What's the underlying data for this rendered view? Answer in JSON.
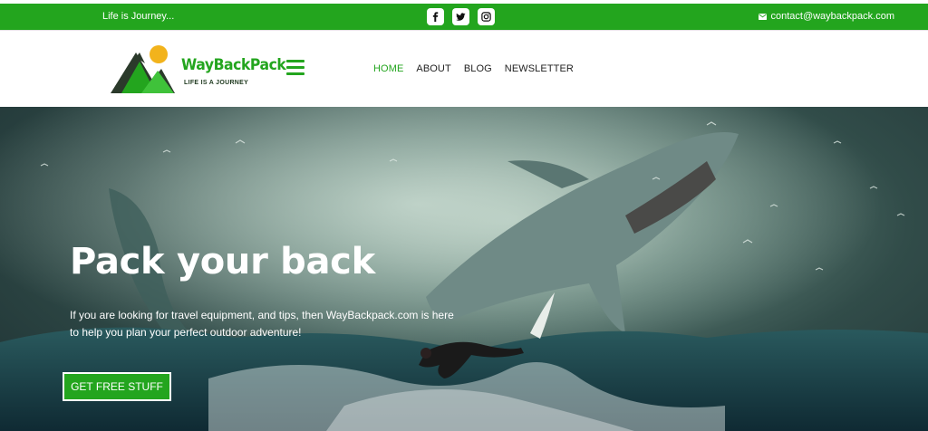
{
  "topbar": {
    "tagline": "Life is Journey...",
    "social": [
      {
        "name": "facebook-icon"
      },
      {
        "name": "twitter-icon"
      },
      {
        "name": "instagram-icon"
      }
    ],
    "contact_email": "contact@waybackpack.com",
    "color": "#23a51e"
  },
  "header": {
    "brand": "WayBackPack",
    "brand_sub": "LIFE IS A JOURNEY",
    "nav": [
      {
        "label": "HOME",
        "active": true
      },
      {
        "label": "ABOUT",
        "active": false
      },
      {
        "label": "BLOG",
        "active": false
      },
      {
        "label": "NEWSLETTER",
        "active": false
      }
    ]
  },
  "hero": {
    "title": "Pack your back",
    "text": "If you are looking for travel equipment, and tips, then WayBackpack.com is here to help you plan your perfect outdoor adventure!",
    "cta_label": "GET FREE STUFF"
  }
}
